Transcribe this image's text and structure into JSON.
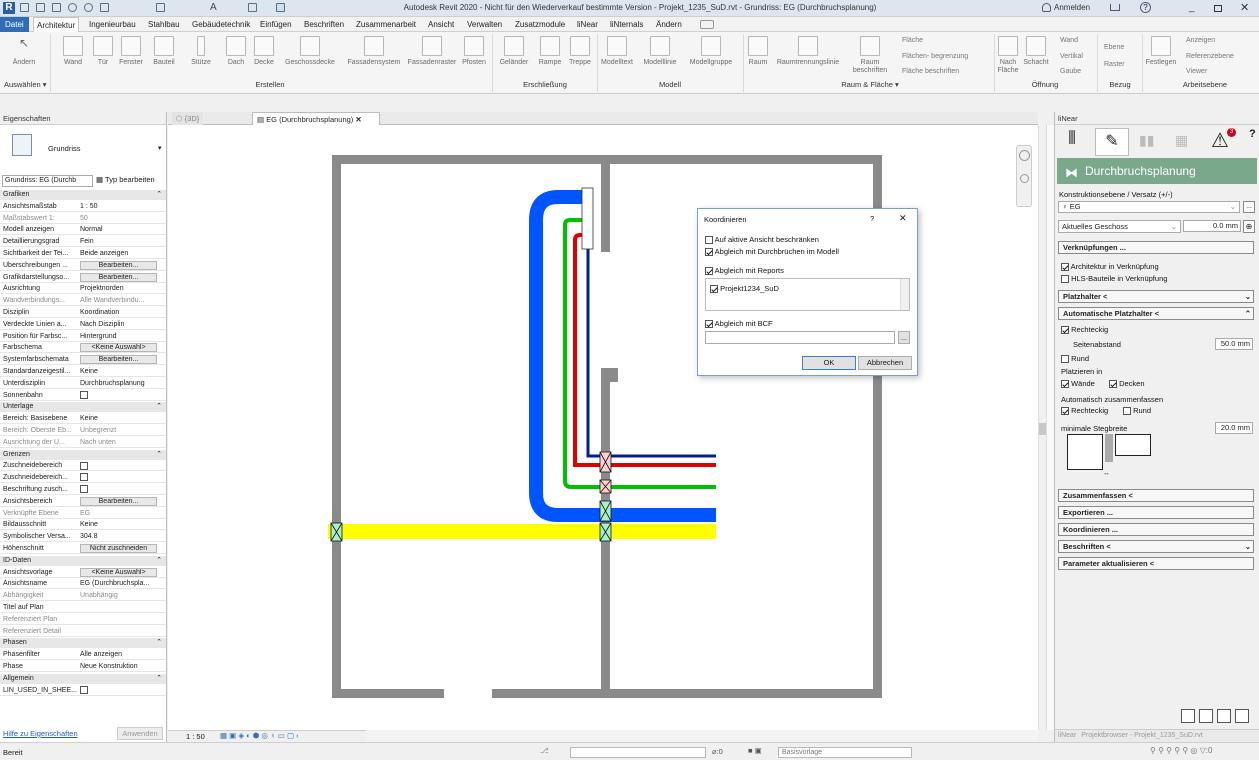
{
  "window": {
    "title": "Autodesk Revit 2020 - Nicht für den Wiederverkauf bestimmte Version - Projekt_1235_SuD.rvt - Grundriss: EG (Durchbruchsplanung)",
    "user": "Anmelden",
    "help": "?"
  },
  "menu": [
    "Datei",
    "Architektur",
    "Ingenieurbau",
    "Stahlbau",
    "Gebäudetechnik",
    "Einfügen",
    "Beschriften",
    "Zusammenarbeit",
    "Ansicht",
    "Verwalten",
    "Zusatzmodule",
    "liNear",
    "liNternals",
    "Ändern"
  ],
  "ribbon": {
    "buttons": [
      "Ändern",
      "Wand",
      "Tür",
      "Fenster",
      "Bauteil",
      "Stütze",
      "Dach",
      "Decke",
      "Geschossdecke",
      "Fassadensystem",
      "Fassadenraster",
      "Pfosten",
      "Geländer",
      "Rampe",
      "Treppe",
      "Modelltext",
      "Modelllinie",
      "Modellgruppe",
      "Raum",
      "Raumtrennungslinie",
      "Raum beschriften",
      "Nach Fläche",
      "Schacht",
      "Ebene",
      "Raster",
      "Festlegen"
    ],
    "small": [
      "Fläche",
      "Flächen- begrenzung",
      "Fläche beschriften",
      "Wand",
      "Vertikal",
      "Gaube",
      "Anzeigen",
      "Referenzebene",
      "Viewer"
    ],
    "groups": [
      "Auswählen",
      "Erstellen",
      "Erschließung",
      "Modell",
      "Raum & Fläche",
      "Öffnung",
      "Bezug",
      "Arbeitsebene"
    ]
  },
  "properties": {
    "title": "Eigenschaften",
    "type_name": "Grundriss",
    "selector": "Grundriss: EG (Durchb",
    "edit_type": "Typ bearbeiten",
    "rows": [
      {
        "k": "Grafiken",
        "sec": true
      },
      {
        "k": "Ansichtsmaßstab",
        "v": "1 : 50"
      },
      {
        "k": "Maßstabswert 1:",
        "v": "50",
        "dim": true
      },
      {
        "k": "Modell anzeigen",
        "v": "Normal"
      },
      {
        "k": "Detaillierungsgrad",
        "v": "Fein"
      },
      {
        "k": "Sichtbarkeit der Tei...",
        "v": "Beide anzeigen"
      },
      {
        "k": "Überschreibungen ...",
        "v": "Bearbeiten...",
        "btn": true
      },
      {
        "k": "Grafikdarstellungso...",
        "v": "Bearbeiten...",
        "btn": true
      },
      {
        "k": "Ausrichtung",
        "v": "Projektnorden"
      },
      {
        "k": "Wandverbindungs...",
        "v": "Alle Wandverbindu...",
        "dim": true
      },
      {
        "k": "Disziplin",
        "v": "Koordination"
      },
      {
        "k": "Verdeckte Linien a...",
        "v": "Nach Disziplin"
      },
      {
        "k": "Position für Farbsc...",
        "v": "Hintergrund"
      },
      {
        "k": "Farbschema",
        "v": "<Keine Auswahl>",
        "btn": true
      },
      {
        "k": "Systemfarbschemata",
        "v": "Bearbeiten...",
        "btn": true
      },
      {
        "k": "Standardanzeigestil...",
        "v": "Keine"
      },
      {
        "k": "Unterdisziplin",
        "v": "Durchbruchsplanung"
      },
      {
        "k": "Sonnenbahn",
        "v": "",
        "cb": true
      },
      {
        "k": "Unterlage",
        "sec": true
      },
      {
        "k": "Bereich: Basisebene",
        "v": "Keine"
      },
      {
        "k": "Bereich: Oberste Eb...",
        "v": "Unbegrenzt",
        "dim": true
      },
      {
        "k": "Ausrichtung der U...",
        "v": "Nach unten",
        "dim": true
      },
      {
        "k": "Grenzen",
        "sec": true
      },
      {
        "k": "Zuschneidebereich",
        "v": "",
        "cb": true
      },
      {
        "k": "Zuschneidebereich...",
        "v": "",
        "cb": true
      },
      {
        "k": "Beschriftung zusch...",
        "v": "",
        "cb": true
      },
      {
        "k": "Ansichtsbereich",
        "v": "Bearbeiten...",
        "btn": true
      },
      {
        "k": "Verknüpfte Ebene",
        "v": "EG",
        "dim": true
      },
      {
        "k": "Bildausschnitt",
        "v": "Keine"
      },
      {
        "k": "Symbolischer Versa...",
        "v": "304.8"
      },
      {
        "k": "Höhenschnitt",
        "v": "Nicht zuschneiden",
        "btn": true
      },
      {
        "k": "ID-Daten",
        "sec": true
      },
      {
        "k": "Ansichtsvorlage",
        "v": "<Keine Auswahl>",
        "btn": true
      },
      {
        "k": "Ansichtsname",
        "v": "EG (Durchbruchspla..."
      },
      {
        "k": "Abhängigkeit",
        "v": "Unabhängig",
        "dim": true
      },
      {
        "k": "Titel auf Plan",
        "v": ""
      },
      {
        "k": "Referenziert Plan",
        "v": "",
        "dim": true
      },
      {
        "k": "Referenziert Detail",
        "v": "",
        "dim": true
      },
      {
        "k": "Phasen",
        "sec": true
      },
      {
        "k": "Phasenfilter",
        "v": "Alle anzeigen"
      },
      {
        "k": "Phase",
        "v": "Neue Konstruktion"
      },
      {
        "k": "Allgemein",
        "sec": true
      },
      {
        "k": "LIN_USED_IN_SHEE...",
        "v": "",
        "cb": true
      }
    ],
    "help_link": "Hilfe zu Eigenschaften",
    "apply": "Anwenden"
  },
  "view_tabs": [
    "{3D}",
    "EG (Durchbruchsplanung)"
  ],
  "dialog": {
    "title": "Koordinieren",
    "help": "?",
    "close": "✕",
    "opt1": "Auf aktive Ansicht beschränken",
    "opt2": "Abgleich mit Durchbrüchen im Modell",
    "opt3": "Abgleich mit Reports",
    "report_item": "Projekt1234_SuD",
    "opt4": "Abgleich mit BCF",
    "browse": "...",
    "ok": "OK",
    "cancel": "Abbrechen"
  },
  "linear": {
    "panel_title": "liNear",
    "header": "Durchbruchsplanung",
    "level_label": "Konstruktionsebene / Versatz (+/-)",
    "level_value": "EG",
    "level_mode": "Aktuelles Geschoss",
    "offset": "0.0 mm",
    "verkn": "Verknüpfungen ...",
    "arch_link": "Architektur in Verknüpfung",
    "hls_link": "HLS-Bauteile in Verknüpfung",
    "platzhalter": "Platzhalter <",
    "auto_platz": "Automatische Platzhalter <",
    "rechteckig": "Rechteckig",
    "seitenabstand": "Seitenabstand",
    "seitenabstand_val": "50.0 mm",
    "rund": "Rund",
    "platzieren": "Platzieren in",
    "waende": "Wände",
    "decken": "Decken",
    "auto_zus": "Automatisch zusammenfassen",
    "rechteckig2": "Rechteckig",
    "rund2": "Rund",
    "min_steg": "minimale Stegbreite",
    "min_steg_val": "20.0 mm",
    "zusammenfassen": "Zusammenfassen <",
    "exportieren": "Exportieren ...",
    "koordinieren": "Koordinieren ...",
    "beschriften": "Beschriften <",
    "param": "Parameter aktualisieren <",
    "bottom_tabs": [
      "liNear",
      "Projektbrowser - Projekt_1235_SuD.rvt"
    ],
    "warning_count": "3"
  },
  "status": {
    "ready": "Bereit",
    "scale": "1 : 50",
    "zero": ":0",
    "template": "Basisvorlage",
    "filter": ":0"
  },
  "colors": {
    "pipe_blue": "#0055ff",
    "pipe_darkblue": "#00208c",
    "pipe_green": "#00c000",
    "pipe_red": "#e00000",
    "pipe_yellow": "#ffff00",
    "accent": "#2f6db5",
    "linear_header": "#7aa88a"
  }
}
